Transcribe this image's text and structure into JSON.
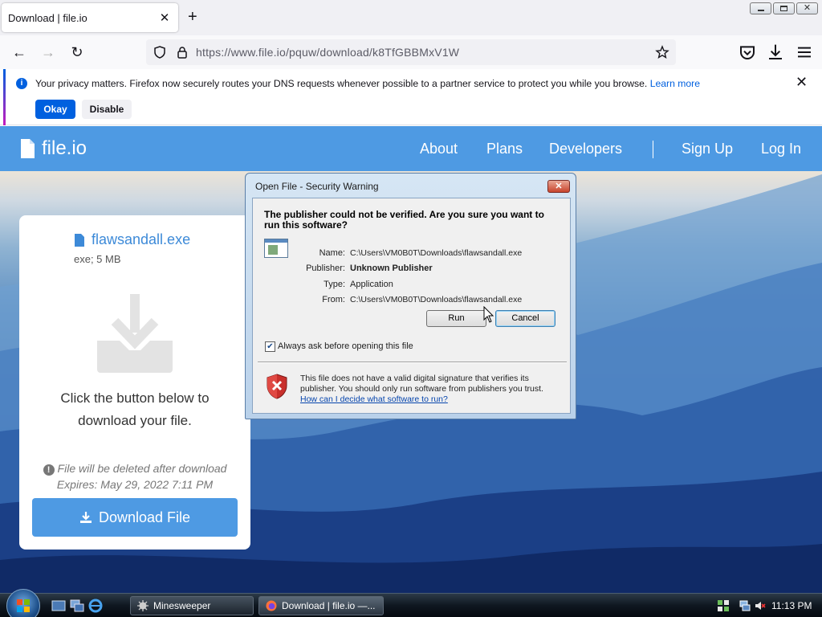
{
  "browser": {
    "tab_title": "Download | file.io",
    "url": "https://www.file.io/pquw/download/k8TfGBBMxV1W"
  },
  "notification": {
    "text": "Your privacy matters. Firefox now securely routes your DNS requests whenever possible to a partner service to protect you while you browse.",
    "link": "Learn more",
    "okay": "Okay",
    "disable": "Disable"
  },
  "site": {
    "logo": "file.io",
    "nav": {
      "about": "About",
      "plans": "Plans",
      "developers": "Developers",
      "signup": "Sign Up",
      "login": "Log In"
    }
  },
  "card": {
    "file_name": "flawsandall.exe",
    "file_meta": "exe; 5 MB",
    "message_line1": "Click the button below to",
    "message_line2": "download your file.",
    "note_line1": "File will be deleted after download",
    "note_line2": "Expires: May 29, 2022 7:11 PM",
    "download_label": "Download File"
  },
  "dialog": {
    "title": "Open File - Security Warning",
    "question": "The publisher could not be verified.  Are you sure you want to run this software?",
    "name_label": "Name:",
    "name_value": "C:\\Users\\VM0B0T\\Downloads\\flawsandall.exe",
    "publisher_label": "Publisher:",
    "publisher_value": "Unknown Publisher",
    "type_label": "Type:",
    "type_value": "Application",
    "from_label": "From:",
    "from_value": "C:\\Users\\VM0B0T\\Downloads\\flawsandall.exe",
    "run": "Run",
    "cancel": "Cancel",
    "checkbox_label": "Always ask before opening this file",
    "checkbox_checked": true,
    "warning": "This file does not have a valid digital signature that verifies its publisher.  You should only run software from publishers you trust.",
    "link": "How can I decide what software to run?"
  },
  "taskbar": {
    "minesweeper": "Minesweeper",
    "firefox": "Download | file.io —...",
    "clock": "11:13 PM"
  }
}
